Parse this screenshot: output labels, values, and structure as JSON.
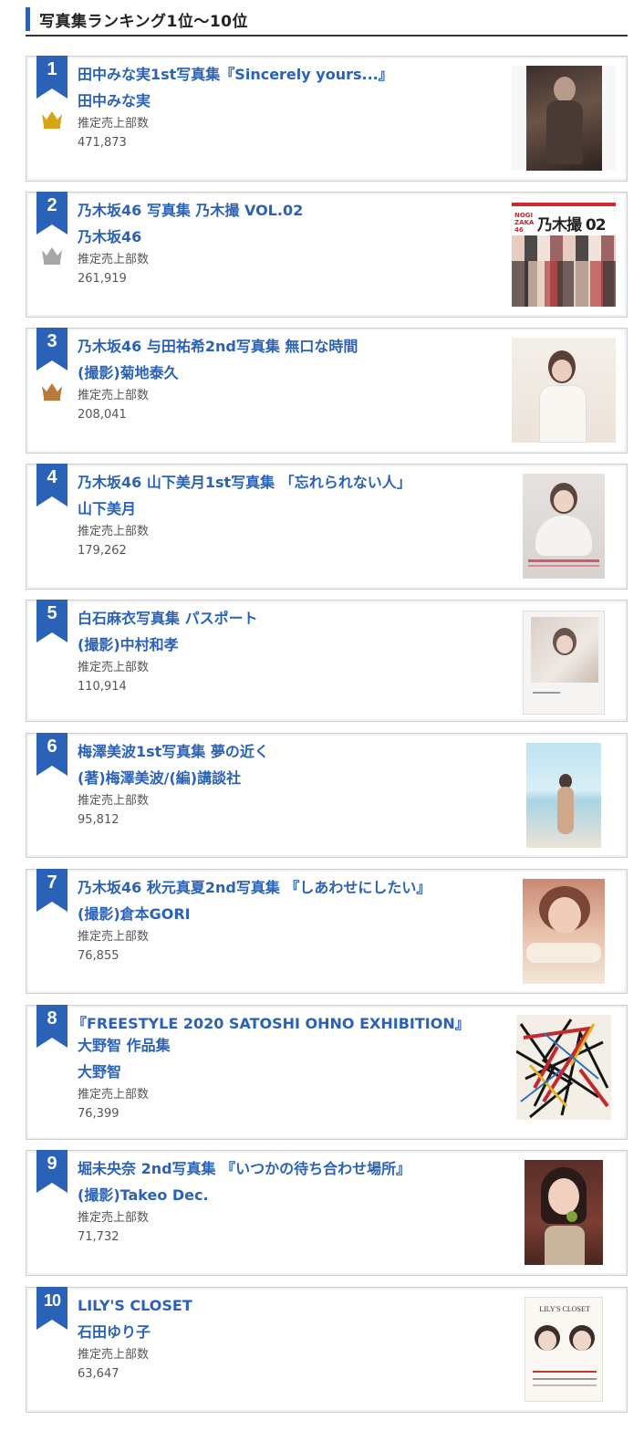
{
  "header": {
    "title": "写真集ランキング1位〜10位"
  },
  "colors": {
    "accent": "#2a62b8",
    "gold": "#d6a414",
    "silver": "#a7a7a7",
    "bronze": "#b77a3b"
  },
  "sales_label": "推定売上部数",
  "items": [
    {
      "rank": "1",
      "title": "田中みな実1st写真集『Sincerely yours...』",
      "author": "田中みな実",
      "sales": "471,873",
      "crown": "gold-crown-icon"
    },
    {
      "rank": "2",
      "title": "乃木坂46 写真集 乃木撮 VOL.02",
      "author": "乃木坂46",
      "sales": "261,919",
      "crown": "silver-crown-icon",
      "cover_text": "乃木撮 02",
      "cover_small": "NOGI ZAKA 46"
    },
    {
      "rank": "3",
      "title": "乃木坂46 与田祐希2nd写真集 無口な時間",
      "author": "(撮影)菊地泰久",
      "sales": "208,041",
      "crown": "bronze-crown-icon"
    },
    {
      "rank": "4",
      "title": "乃木坂46 山下美月1st写真集 「忘れられない人」",
      "author": "山下美月",
      "sales": "179,262"
    },
    {
      "rank": "5",
      "title": "白石麻衣写真集 パスポート",
      "author": "(撮影)中村和孝",
      "sales": "110,914"
    },
    {
      "rank": "6",
      "title": "梅澤美波1st写真集 夢の近く",
      "author": "(著)梅澤美波/(編)講談社",
      "sales": "95,812"
    },
    {
      "rank": "7",
      "title": "乃木坂46 秋元真夏2nd写真集 『しあわせにしたい』",
      "author": "(撮影)倉本GORI",
      "sales": "76,855"
    },
    {
      "rank": "8",
      "title": "『FREESTYLE 2020 SATOSHI OHNO EXHIBITION』",
      "title2": "大野智 作品集",
      "author": "大野智",
      "sales": "76,399"
    },
    {
      "rank": "9",
      "title": "堀未央奈 2nd写真集 『いつかの待ち合わせ場所』",
      "author": "(撮影)Takeo Dec.",
      "sales": "71,732"
    },
    {
      "rank": "10",
      "title": "LILY'S CLOSET",
      "author": "石田ゆり子",
      "sales": "63,647",
      "cover_text": "LILY'S CLOSET"
    }
  ]
}
